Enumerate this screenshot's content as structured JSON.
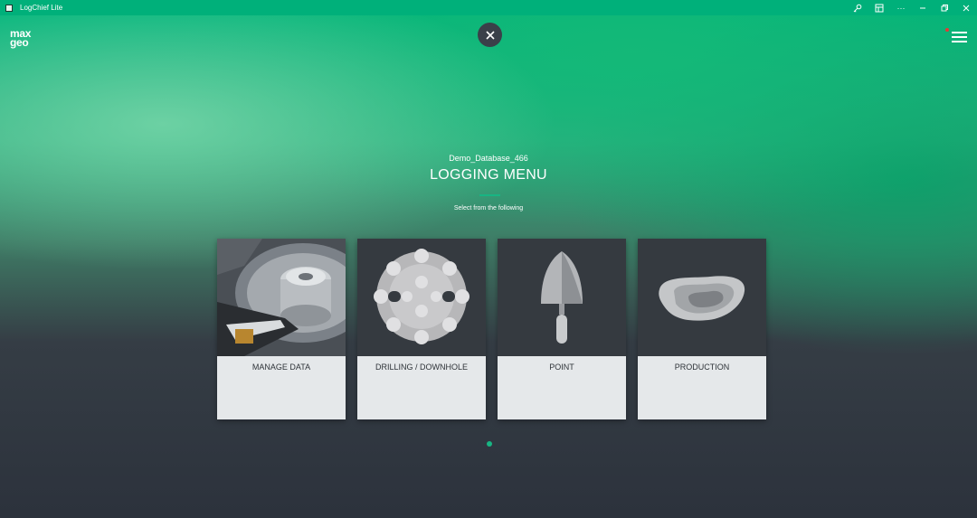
{
  "window": {
    "title": "LogChief Lite",
    "controls": [
      "key-icon",
      "layout-icon",
      "more-icon",
      "minimize-icon",
      "restore-icon",
      "close-icon"
    ]
  },
  "logo": {
    "line1": "max",
    "line2": "geo"
  },
  "header": {
    "database": "Demo_Database_466",
    "title": "LOGGING MENU",
    "subtitle": "Select from the following"
  },
  "cards": [
    {
      "label": "MANAGE DATA",
      "icon": "hard-drive-image"
    },
    {
      "label": "DRILLING / DOWNHOLE",
      "icon": "drill-bit-image"
    },
    {
      "label": "POINT",
      "icon": "trowel-image"
    },
    {
      "label": "PRODUCTION",
      "icon": "rock-sample-image"
    }
  ],
  "pagination": {
    "pages": 1,
    "current": 1
  },
  "colors": {
    "accent": "#18b583",
    "titlebar": "#00b07a",
    "card_bg": "#e5e8ea",
    "card_image_bg": "#353a40"
  }
}
